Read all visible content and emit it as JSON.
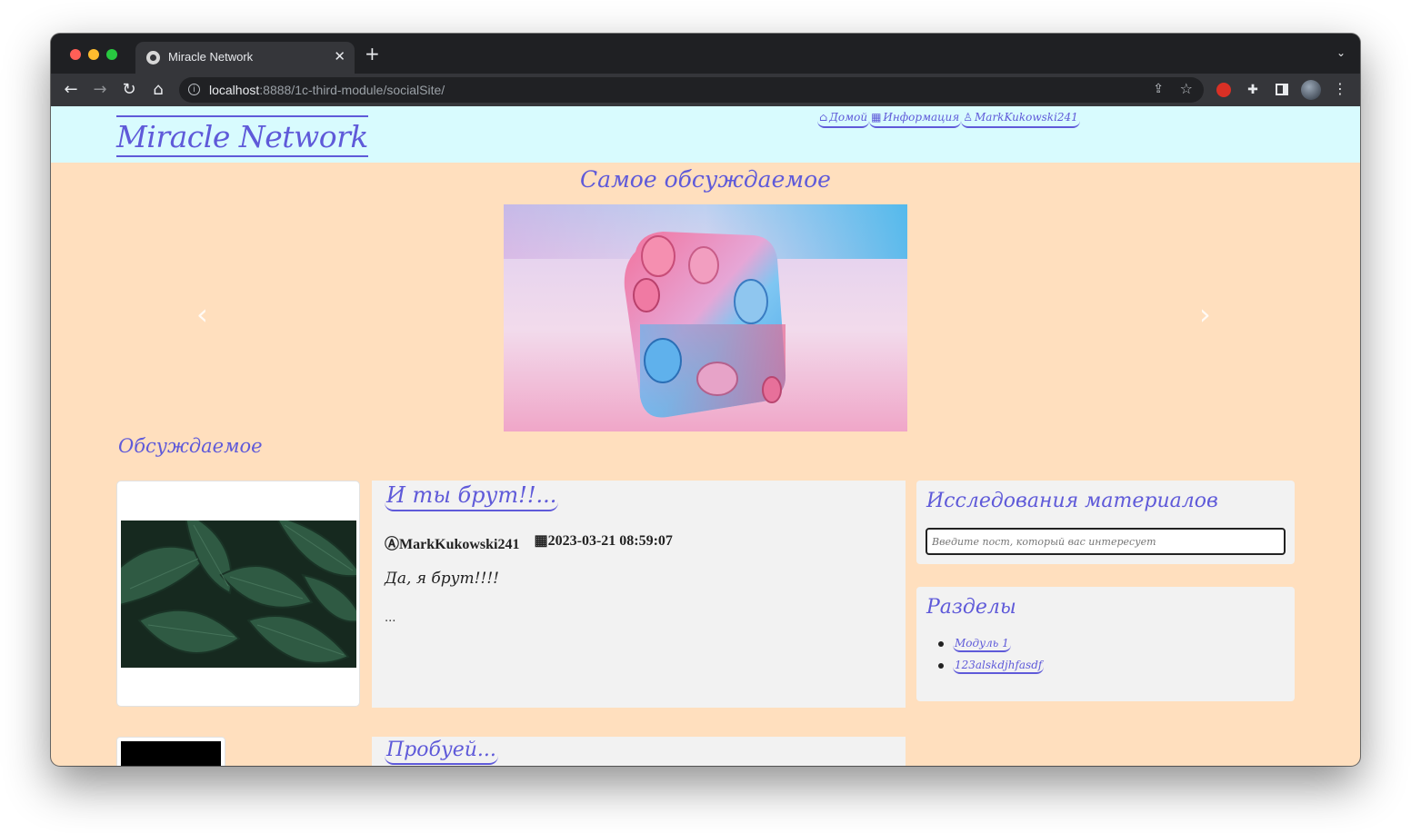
{
  "browser": {
    "tab_title": "Miracle Network",
    "tab_close": "✕",
    "new_tab": "+",
    "url_host": "localhost",
    "url_rest": ":8888/1c-third-module/socialSite/"
  },
  "site": {
    "logo": "Miracle Network",
    "nav": [
      {
        "label": "Домой",
        "icon": "home-icon"
      },
      {
        "label": "Информация",
        "icon": "calendar-icon"
      },
      {
        "label": "MarkKukowski241",
        "icon": "user-icon"
      }
    ]
  },
  "featured": {
    "title": "Самое обсуждаемое",
    "prev": "‹",
    "next": "›"
  },
  "discussed": {
    "heading": "Обсуждаемое",
    "posts": [
      {
        "title": "И ты брут!!...",
        "author": "MarkKukowski241",
        "date": "2023-03-21 08:59:07",
        "text": "Да, я брут!!!!",
        "more": "..."
      },
      {
        "title": "Пробуей..."
      }
    ]
  },
  "sidebar": {
    "search_title": "Исследования материалов",
    "search_placeholder": "Введите пост, который вас интересует",
    "sections_title": "Разделы",
    "sections": [
      "Модуль 1",
      "123alskdjhfasdf"
    ]
  }
}
